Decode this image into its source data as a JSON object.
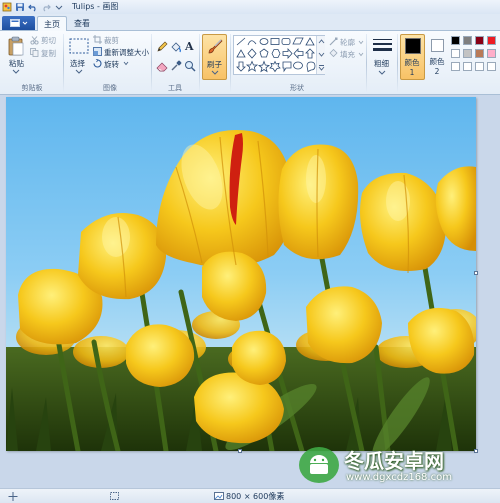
{
  "window": {
    "title": "Tulips - 画图"
  },
  "tabs": {
    "home": "主页",
    "view": "查看"
  },
  "clipboard": {
    "paste_label": "粘贴",
    "cut_label": "剪切",
    "copy_label": "复制",
    "group_label": "剪贴板"
  },
  "image": {
    "select_label": "选择",
    "crop_label": "裁剪",
    "resize_label": "重新调整大小",
    "rotate_label": "旋转",
    "group_label": "图像"
  },
  "tools": {
    "text_tool_glyph": "A",
    "group_label": "工具"
  },
  "brushes": {
    "label": "刷子"
  },
  "shapes": {
    "outline_label": "轮廓",
    "fill_label": "填充",
    "group_label": "形状"
  },
  "size": {
    "label": "粗细"
  },
  "colors": {
    "color1_label": "颜色 1",
    "color2_label": "颜色 2",
    "color1": "#000000",
    "color2": "#ffffff",
    "palette": [
      "#000000",
      "#7f7f7f",
      "#880015",
      "#ed1c24",
      "#ffffff",
      "#c3c3c3",
      "#b97a57",
      "#ffaec9",
      "#ffffff",
      "#ffffff",
      "#ffffff",
      "#ffffff"
    ]
  },
  "status": {
    "dimensions": "800 × 600像素"
  },
  "watermark": {
    "title": "冬瓜安卓网",
    "url": "www.dgxcdz168.com"
  }
}
